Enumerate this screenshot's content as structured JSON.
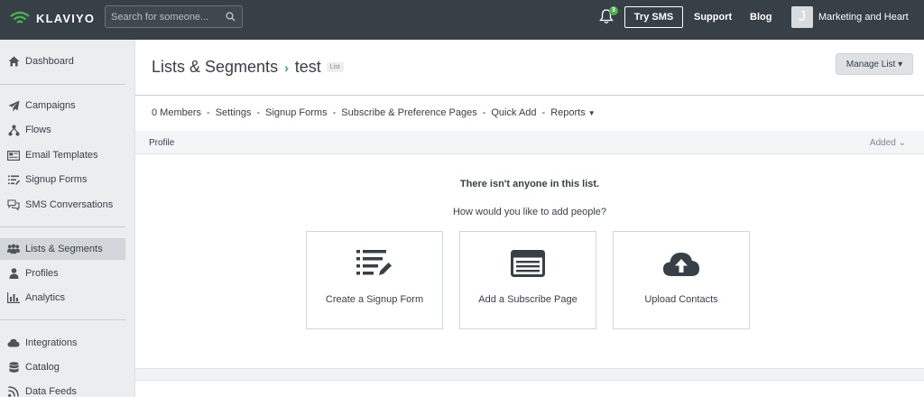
{
  "topbar": {
    "brand": "KLAVIYO",
    "search_placeholder": "Search for someone...",
    "notification_count": "3",
    "try_sms": "Try SMS",
    "support": "Support",
    "blog": "Blog",
    "avatar_initial": "J",
    "account_name": "Marketing and Heart"
  },
  "sidebar": {
    "items": [
      {
        "label": "Dashboard",
        "icon": "home-icon"
      },
      {
        "label": "Campaigns",
        "icon": "send-icon"
      },
      {
        "label": "Flows",
        "icon": "flows-icon"
      },
      {
        "label": "Email Templates",
        "icon": "template-icon"
      },
      {
        "label": "Signup Forms",
        "icon": "form-icon"
      },
      {
        "label": "SMS Conversations",
        "icon": "chat-icon"
      },
      {
        "label": "Lists & Segments",
        "icon": "users-icon"
      },
      {
        "label": "Profiles",
        "icon": "user-icon"
      },
      {
        "label": "Analytics",
        "icon": "chart-icon"
      },
      {
        "label": "Integrations",
        "icon": "cloud-icon"
      },
      {
        "label": "Catalog",
        "icon": "database-icon"
      },
      {
        "label": "Data Feeds",
        "icon": "rss-icon"
      }
    ],
    "active": "Lists & Segments"
  },
  "header": {
    "breadcrumb_root": "Lists & Segments",
    "breadcrumb_sep": "›",
    "current": "test",
    "tag": "List",
    "manage_button": "Manage List ▾"
  },
  "subnav": {
    "members": "0 Members",
    "settings": "Settings",
    "signup_forms": "Signup Forms",
    "subscribe_pages": "Subscribe & Preference Pages",
    "quick_add": "Quick Add",
    "reports": "Reports",
    "dash": "-"
  },
  "table": {
    "col_profile": "Profile",
    "col_added": "Added ⌄"
  },
  "empty": {
    "title": "There isn't anyone in this list.",
    "subtitle": "How would you like to add people?"
  },
  "cards": [
    {
      "label": "Create a Signup Form",
      "icon": "list-edit-icon"
    },
    {
      "label": "Add a Subscribe Page",
      "icon": "newspaper-icon"
    },
    {
      "label": "Upload Contacts",
      "icon": "cloud-upload-icon"
    }
  ],
  "colors": {
    "topbar": "#373f47",
    "sidebar": "#ebedef",
    "accent": "#2f9e8f",
    "badge": "#4caf50"
  }
}
